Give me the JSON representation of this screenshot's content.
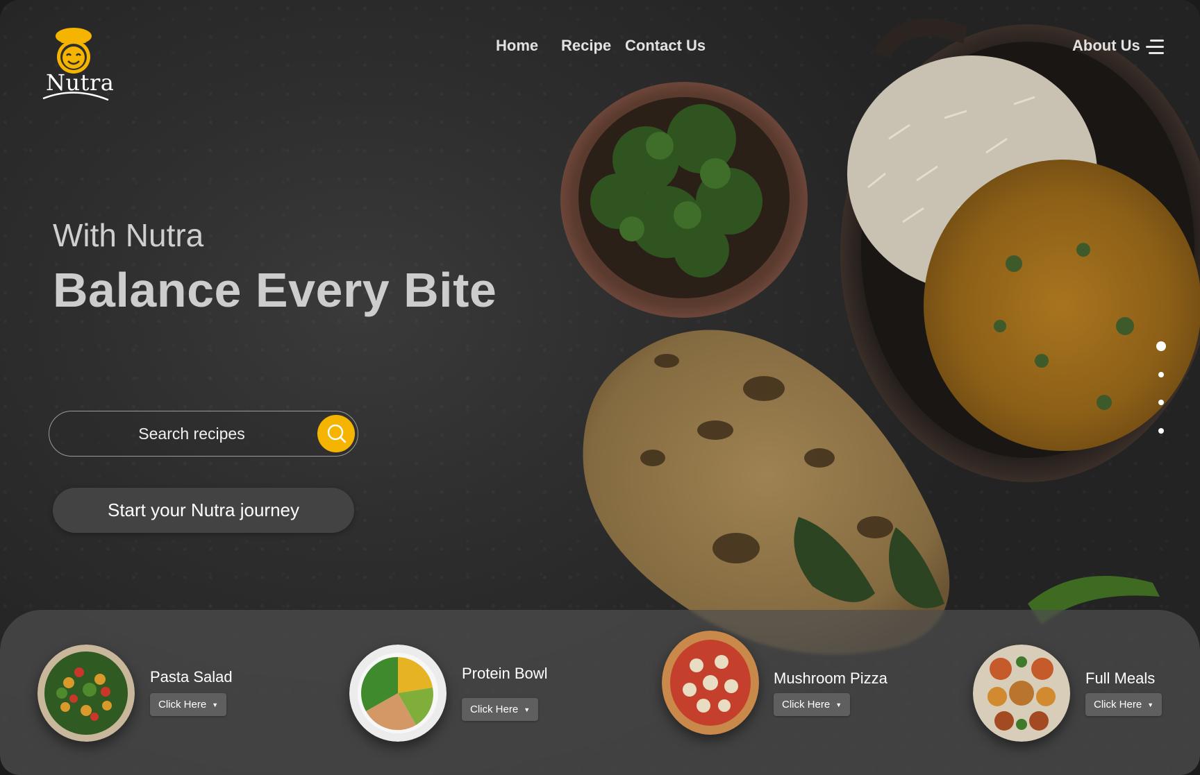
{
  "brand": {
    "name": "Nutra"
  },
  "nav": {
    "home": "Home",
    "recipe": "Recipe",
    "contact": "Contact Us",
    "about": "About Us"
  },
  "hero": {
    "subtitle": "With Nutra",
    "title": "Balance Every Bite"
  },
  "search": {
    "placeholder": "Search recipes"
  },
  "cta": {
    "label": "Start your Nutra journey"
  },
  "carousel": {
    "slide_count": 4,
    "active_index": 0
  },
  "categories": [
    {
      "name": "Pasta Salad",
      "button": "Click Here"
    },
    {
      "name": "Protein Bowl",
      "button": "Click Here"
    },
    {
      "name": "Mushroom Pizza",
      "button": "Click Here"
    },
    {
      "name": "Full Meals",
      "button": "Click Here"
    }
  ],
  "colors": {
    "accent": "#f5b400",
    "background": "#2e2e2e",
    "panel": "#4e4e4e",
    "button": "#5f5f5f"
  }
}
